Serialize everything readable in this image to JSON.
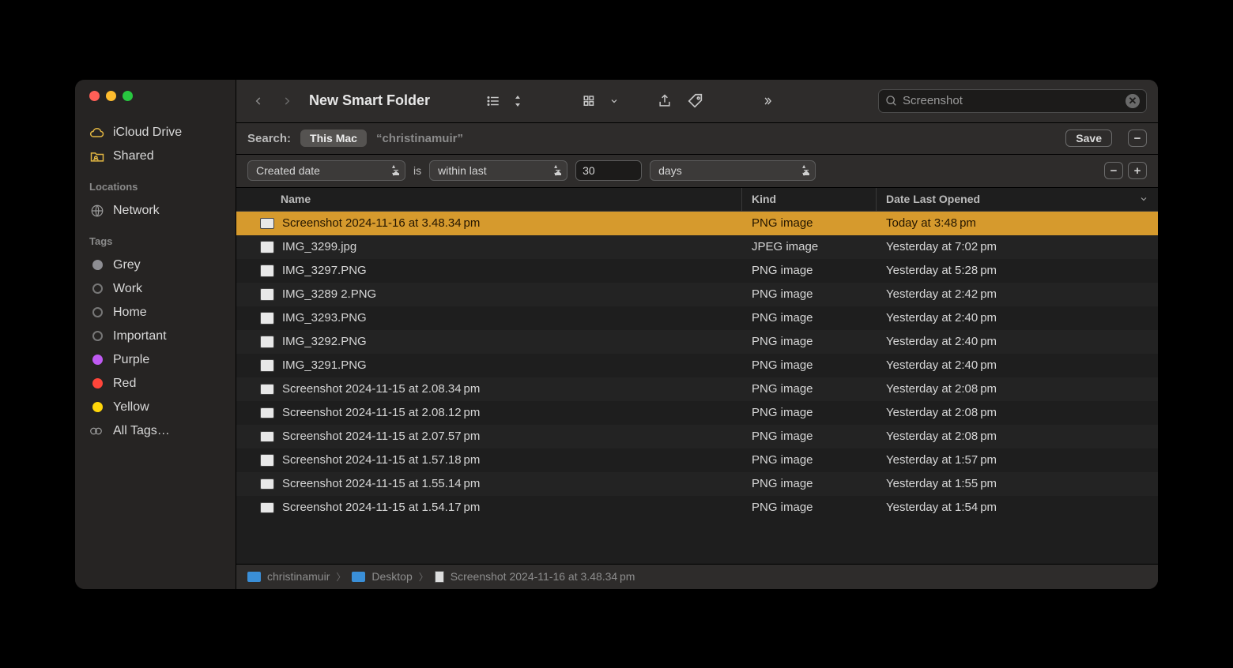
{
  "window_title": "New Smart Folder",
  "search_value": "Screenshot",
  "sidebar": {
    "favorites": [
      {
        "label": "iCloud Drive",
        "icon": "cloud-icon"
      },
      {
        "label": "Shared",
        "icon": "shared-folder-icon"
      }
    ],
    "locations_header": "Locations",
    "locations": [
      {
        "label": "Network",
        "icon": "globe-icon"
      }
    ],
    "tags_header": "Tags",
    "tags": [
      {
        "label": "Grey",
        "color": "#8e8e93",
        "filled": true
      },
      {
        "label": "Work",
        "color": "",
        "filled": false
      },
      {
        "label": "Home",
        "color": "",
        "filled": false
      },
      {
        "label": "Important",
        "color": "",
        "filled": false
      },
      {
        "label": "Purple",
        "color": "#bf5af2",
        "filled": true
      },
      {
        "label": "Red",
        "color": "#ff453a",
        "filled": true
      },
      {
        "label": "Yellow",
        "color": "#ffd60a",
        "filled": true
      }
    ],
    "all_tags_label": "All Tags…"
  },
  "scope": {
    "label": "Search:",
    "active": "This Mac",
    "alt": "“christinamuir”",
    "save_label": "Save"
  },
  "criteria": {
    "attribute": "Created date",
    "verb": "is",
    "range": "within last",
    "number": "30",
    "unit": "days"
  },
  "columns": {
    "name": "Name",
    "kind": "Kind",
    "date": "Date Last Opened"
  },
  "files": [
    {
      "name": "Screenshot 2024-11-16 at 3.48.34 pm",
      "kind": "PNG image",
      "date": "Today at 3:48 pm",
      "selected": true,
      "thumb": "land"
    },
    {
      "name": "IMG_3299.jpg",
      "kind": "JPEG image",
      "date": "Yesterday at 7:02 pm",
      "selected": false,
      "thumb": "port"
    },
    {
      "name": "IMG_3297.PNG",
      "kind": "PNG image",
      "date": "Yesterday at 5:28 pm",
      "selected": false,
      "thumb": "port"
    },
    {
      "name": "IMG_3289 2.PNG",
      "kind": "PNG image",
      "date": "Yesterday at 2:42 pm",
      "selected": false,
      "thumb": "port"
    },
    {
      "name": "IMG_3293.PNG",
      "kind": "PNG image",
      "date": "Yesterday at 2:40 pm",
      "selected": false,
      "thumb": "port"
    },
    {
      "name": "IMG_3292.PNG",
      "kind": "PNG image",
      "date": "Yesterday at 2:40 pm",
      "selected": false,
      "thumb": "port"
    },
    {
      "name": "IMG_3291.PNG",
      "kind": "PNG image",
      "date": "Yesterday at 2:40 pm",
      "selected": false,
      "thumb": "port"
    },
    {
      "name": "Screenshot 2024-11-15 at 2.08.34 pm",
      "kind": "PNG image",
      "date": "Yesterday at 2:08 pm",
      "selected": false,
      "thumb": "land"
    },
    {
      "name": "Screenshot 2024-11-15 at 2.08.12 pm",
      "kind": "PNG image",
      "date": "Yesterday at 2:08 pm",
      "selected": false,
      "thumb": "land"
    },
    {
      "name": "Screenshot 2024-11-15 at 2.07.57 pm",
      "kind": "PNG image",
      "date": "Yesterday at 2:08 pm",
      "selected": false,
      "thumb": "land"
    },
    {
      "name": "Screenshot 2024-11-15 at 1.57.18 pm",
      "kind": "PNG image",
      "date": "Yesterday at 1:57 pm",
      "selected": false,
      "thumb": "port"
    },
    {
      "name": "Screenshot 2024-11-15 at 1.55.14 pm",
      "kind": "PNG image",
      "date": "Yesterday at 1:55 pm",
      "selected": false,
      "thumb": "land"
    },
    {
      "name": "Screenshot 2024-11-15 at 1.54.17 pm",
      "kind": "PNG image",
      "date": "Yesterday at 1:54 pm",
      "selected": false,
      "thumb": "land"
    }
  ],
  "pathbar": {
    "parts": [
      {
        "label": "christinamuir",
        "icon": "home-folder-icon"
      },
      {
        "label": "Desktop",
        "icon": "folder-icon"
      },
      {
        "label": "Screenshot 2024-11-16 at 3.48.34 pm",
        "icon": "file-icon"
      }
    ]
  }
}
